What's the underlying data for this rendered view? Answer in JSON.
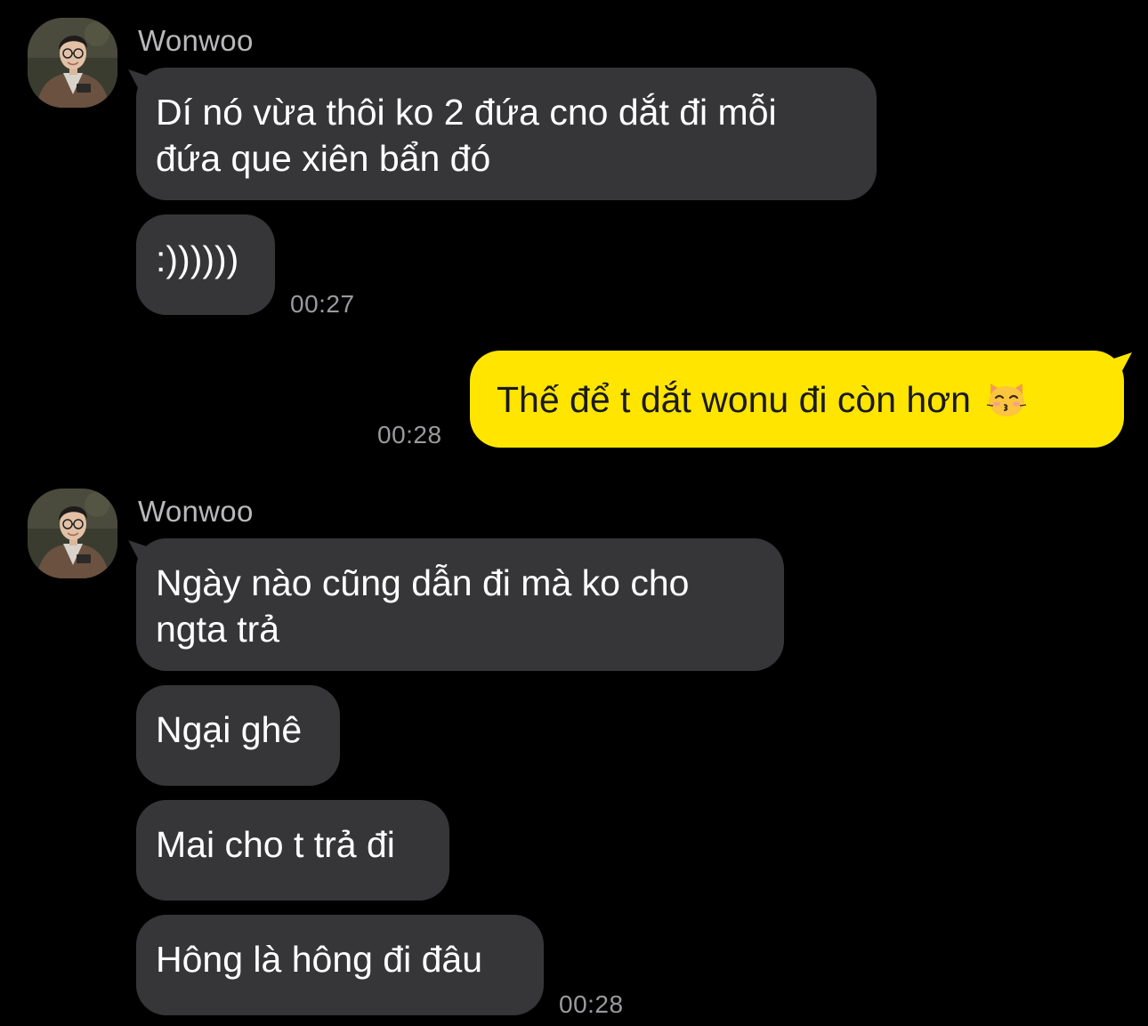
{
  "chat": {
    "groups": [
      {
        "sender": "Wonwoo",
        "messages": [
          {
            "lines": [
              "Dí nó vừa thôi ko 2 đứa cno dắt đi mỗi",
              "đứa que xiên bẩn đó"
            ]
          },
          {
            "lines": [
              ":))))))"
            ],
            "time": "00:27"
          }
        ]
      },
      {
        "sender": "me",
        "messages": [
          {
            "text": "Thế để t dắt wonu đi còn hơn",
            "emoji": "kissing-cat-emoji",
            "time": "00:28"
          }
        ]
      },
      {
        "sender": "Wonwoo",
        "messages": [
          {
            "lines": [
              "Ngày nào cũng dẫn đi mà ko cho",
              "ngta trả"
            ]
          },
          {
            "lines": [
              "Ngại ghê"
            ]
          },
          {
            "lines": [
              "Mai cho t trả đi"
            ]
          },
          {
            "lines": [
              "Hông là hông đi đâu"
            ],
            "time": "00:28"
          }
        ]
      }
    ]
  },
  "colors": {
    "background": "#000000",
    "incoming_bubble": "#363638",
    "outgoing_bubble": "#ffe500",
    "sender_name": "#b9b9bc",
    "timestamp": "#9a9a9e"
  },
  "icons": {
    "avatar": "profile-photo-avatar",
    "emoji": "kissing-cat-emoji"
  }
}
